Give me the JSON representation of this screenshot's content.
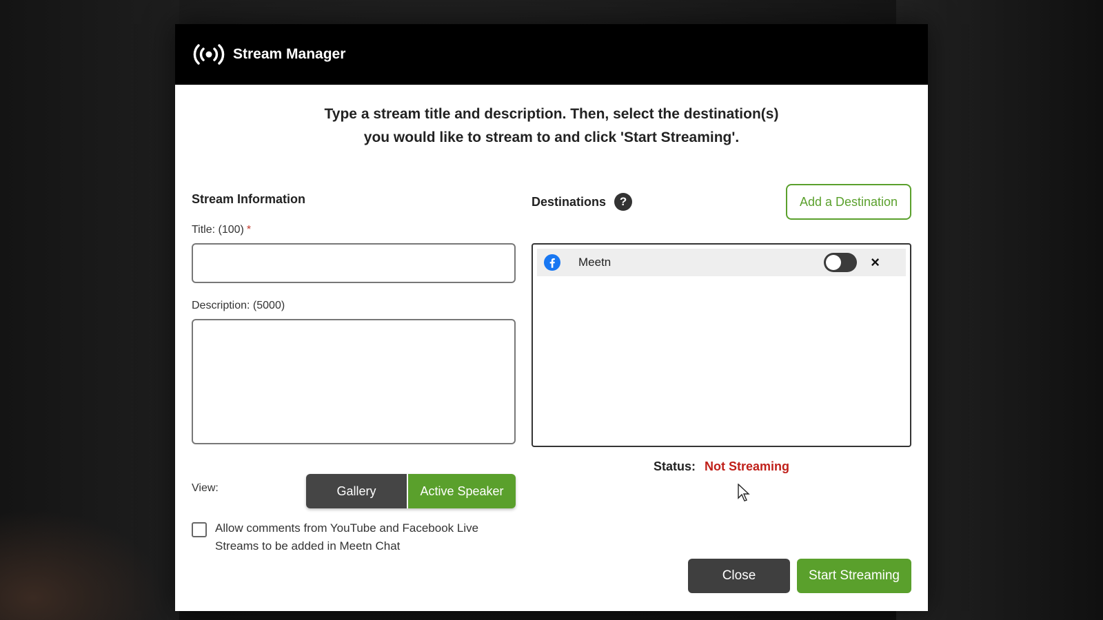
{
  "modal": {
    "title": "Stream Manager",
    "instructions_line1": "Type a stream title and description. Then, select the destination(s)",
    "instructions_line2": "you would like to stream to and click 'Start Streaming'."
  },
  "stream_info": {
    "heading": "Stream Information",
    "title_label": "Title: (100)",
    "required_mark": "*",
    "title_value": "",
    "description_label": "Description: (5000)",
    "description_value": "",
    "view_label": "View:",
    "view_options": [
      "Gallery",
      "Active Speaker"
    ],
    "view_selected": "Active Speaker",
    "allow_comments_label": "Allow comments from YouTube and Facebook Live Streams to be added in Meetn Chat",
    "allow_comments_checked": false
  },
  "destinations": {
    "heading": "Destinations",
    "help_icon": "?",
    "add_button": "Add a Destination",
    "items": [
      {
        "platform_icon": "facebook-icon",
        "name": "Meetn",
        "enabled": false
      }
    ],
    "remove_icon": "×",
    "status_label": "Status:",
    "status_value": "Not Streaming"
  },
  "footer": {
    "close_label": "Close",
    "start_label": "Start Streaming"
  },
  "colors": {
    "accent_green": "#5aa02c",
    "status_red": "#c0201a",
    "header_black": "#000000",
    "facebook_blue": "#1877f2"
  }
}
